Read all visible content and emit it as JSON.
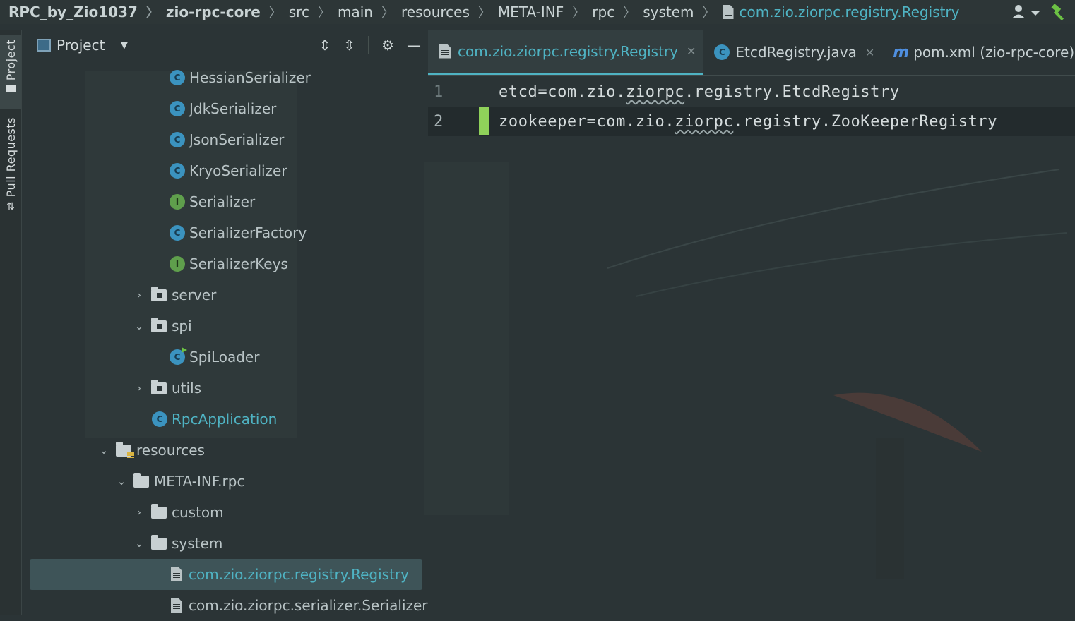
{
  "breadcrumb": {
    "items": [
      "RPC_by_Zio1037",
      "zio-rpc-core",
      "src",
      "main",
      "resources",
      "META-INF",
      "rpc",
      "system",
      "com.zio.ziorpc.registry.Registry"
    ],
    "icons": [
      "user-menu-icon",
      "build-hammer-icon"
    ]
  },
  "toolstrip": {
    "project_label": "Project",
    "pull_requests_label": "Pull Requests"
  },
  "project_panel": {
    "title": "Project",
    "tools": [
      "expand-all-icon",
      "collapse-all-icon",
      "settings-gear-icon",
      "minimize-icon"
    ],
    "tree": [
      {
        "label": "HessianSerializer",
        "kind": "class"
      },
      {
        "label": "JdkSerializer",
        "kind": "class"
      },
      {
        "label": "JsonSerializer",
        "kind": "class"
      },
      {
        "label": "KryoSerializer",
        "kind": "class"
      },
      {
        "label": "Serializer",
        "kind": "interface"
      },
      {
        "label": "SerializerFactory",
        "kind": "class"
      },
      {
        "label": "SerializerKeys",
        "kind": "interface"
      },
      {
        "label": "server",
        "kind": "package",
        "expanded": false
      },
      {
        "label": "spi",
        "kind": "package",
        "expanded": true
      },
      {
        "label": "SpiLoader",
        "kind": "class"
      },
      {
        "label": "utils",
        "kind": "package",
        "expanded": false
      },
      {
        "label": "RpcApplication",
        "kind": "class"
      },
      {
        "label": "resources",
        "kind": "resources-folder",
        "expanded": true
      },
      {
        "label": "META-INF.rpc",
        "kind": "folder",
        "expanded": true
      },
      {
        "label": "custom",
        "kind": "folder",
        "expanded": false
      },
      {
        "label": "system",
        "kind": "folder",
        "expanded": true
      },
      {
        "label": "com.zio.ziorpc.registry.Registry",
        "kind": "file",
        "selected": true
      },
      {
        "label": "com.zio.ziorpc.serializer.Serializer",
        "kind": "file"
      }
    ]
  },
  "editor": {
    "tabs": [
      {
        "label": "com.zio.ziorpc.registry.Registry",
        "active": true
      },
      {
        "label": "EtcdRegistry.java",
        "active": false
      },
      {
        "label": "pom.xml (zio-rpc-core)",
        "active": false
      }
    ],
    "lines": [
      {
        "num": "1",
        "pre": "etcd=com.zio.",
        "squig": "ziorpc",
        "post": ".registry.EtcdRegistry"
      },
      {
        "num": "2",
        "pre": "zookeeper=com.zio.",
        "squig": "ziorpc",
        "post": ".registry.ZooKeeperRegistry"
      }
    ]
  },
  "colors": {
    "accent": "#4fb3c3",
    "background": "#2b3436",
    "change_marker": "#8fd15a"
  }
}
